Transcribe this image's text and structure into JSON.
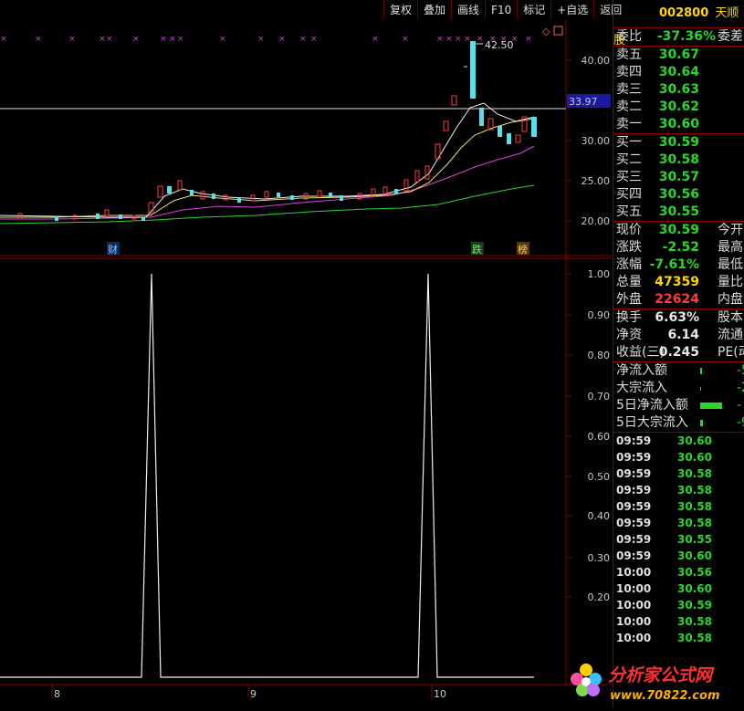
{
  "toolbar": {
    "buttons": [
      "复权",
      "叠加",
      "画线",
      "F10",
      "标记",
      "+自选",
      "返回"
    ]
  },
  "chart": {
    "price_axis": [
      "40.00",
      "35.00",
      "30.00",
      "25.00",
      "20.00"
    ],
    "last_price_tag": "33.97",
    "peak_label": "42.50",
    "badges": {
      "cai": "财",
      "die": "跌",
      "bang": "榜"
    },
    "indicator_axis": [
      "1.00",
      "0.90",
      "0.80",
      "0.70",
      "0.60",
      "0.50",
      "0.40",
      "0.30",
      "0.20"
    ],
    "x_ticks": [
      "8",
      "9",
      "10"
    ]
  },
  "chart_data": {
    "type": "line",
    "title": "",
    "x": [
      "8",
      "9",
      "10"
    ],
    "series": [
      {
        "values": [
          0,
          1,
          0,
          1,
          0
        ]
      }
    ],
    "ylim": [
      0,
      1
    ]
  },
  "stock": {
    "code": "002800",
    "name": "天顺股"
  },
  "order_book": {
    "ratio_label": "委比",
    "ratio_value": "-37.36%",
    "ratio_ext": "委差",
    "sell": [
      {
        "label": "卖五",
        "price": "30.67"
      },
      {
        "label": "卖四",
        "price": "30.64"
      },
      {
        "label": "卖三",
        "price": "30.63"
      },
      {
        "label": "卖二",
        "price": "30.62"
      },
      {
        "label": "卖一",
        "price": "30.60"
      }
    ],
    "buy": [
      {
        "label": "买一",
        "price": "30.59"
      },
      {
        "label": "买二",
        "price": "30.58"
      },
      {
        "label": "买三",
        "price": "30.57"
      },
      {
        "label": "买四",
        "price": "30.56"
      },
      {
        "label": "买五",
        "price": "30.55"
      }
    ]
  },
  "quote": {
    "xianjia_label": "现价",
    "xianjia": "30.59",
    "jinkai": "今开",
    "zhangdie_label": "涨跌",
    "zhangdie": "-2.52",
    "zuigao": "最高",
    "zhangfu_label": "涨幅",
    "zhangfu": "-7.61%",
    "zuidi": "最低",
    "zongliang_label": "总量",
    "zongliang": "47359",
    "liangbi": "量比",
    "waipan_label": "外盘",
    "waipan": "22624",
    "neipan": "内盘",
    "huanshou_label": "换手",
    "huanshou": "6.63%",
    "guben": "股本",
    "jingzi_label": "净资",
    "jingzi": "6.14",
    "liutong": "流通",
    "shouyi_label": "收益(三)",
    "shouyi": "0.245",
    "pe": "PE(动"
  },
  "flow": {
    "net_inflow": "净流入额",
    "net_inflow_v": "-5",
    "block_inflow": "大宗流入",
    "block_inflow_v": "-2",
    "net5": "5日净流入额",
    "net5_v": "-",
    "block5": "5日大宗流入",
    "block5_v": "-9"
  },
  "ticks": [
    {
      "t": "09:59",
      "p": "30.60"
    },
    {
      "t": "09:59",
      "p": "30.60"
    },
    {
      "t": "09:59",
      "p": "30.58"
    },
    {
      "t": "09:59",
      "p": "30.58"
    },
    {
      "t": "09:59",
      "p": "30.58"
    },
    {
      "t": "09:59",
      "p": "30.58"
    },
    {
      "t": "09:59",
      "p": "30.55"
    },
    {
      "t": "09:59",
      "p": "30.60"
    },
    {
      "t": "10:00",
      "p": "30.56"
    },
    {
      "t": "10:00",
      "p": "30.60"
    },
    {
      "t": "10:00",
      "p": "30.59"
    },
    {
      "t": "10:00",
      "p": "30.58"
    },
    {
      "t": "10:00",
      "p": "30.58"
    }
  ],
  "watermark": {
    "title": "分析家公式网",
    "url": "www.70822.com"
  },
  "colors": {
    "up": "#ff3c3c",
    "down": "#2bd62b",
    "grid": "#800000",
    "highlight": "#55e0ee"
  }
}
